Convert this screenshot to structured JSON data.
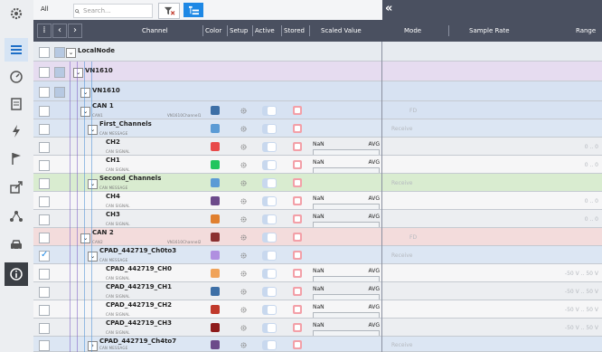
{
  "toolbar": {
    "all_label": "All",
    "search_placeholder": "Search..."
  },
  "header": {
    "columns": [
      "Channel",
      "Color",
      "Setup",
      "Active",
      "Stored",
      "Scaled Value",
      "Mode",
      "Sample Rate",
      "Range"
    ]
  },
  "sidebar": {
    "icons": [
      "gear-icon",
      "list-icon",
      "gauge-icon",
      "document-icon",
      "lightning-icon",
      "flag-icon",
      "export-icon",
      "network-icon",
      "car-icon",
      "info-icon"
    ]
  },
  "rows": [
    {
      "name": "LocalNode",
      "sub": "",
      "indent": 0,
      "mode": "",
      "range": "",
      "checked": false
    },
    {
      "name": "VN1610",
      "sub": "",
      "indent": 1,
      "mode": "",
      "range": "",
      "checked": false
    },
    {
      "name": "VN1610",
      "sub": "",
      "indent": 2,
      "mode": "",
      "range": "",
      "checked": false
    },
    {
      "name": "CAN 1",
      "sub": "CAN1",
      "sub_right": "VN1610Channel1",
      "indent": 3,
      "color": "#3d6fa6",
      "mode": "FD",
      "range": "",
      "checked": false
    },
    {
      "name": "First_Channels",
      "sub": "CAN MESSAGE",
      "indent": 4,
      "color": "#5b9bd5",
      "mode": "Receive",
      "range": "",
      "checked": false
    },
    {
      "name": "CH2",
      "sub": "CAN SIGNAL",
      "indent": 5,
      "color": "#e84a4a",
      "mode": "",
      "range": "0 .. 0",
      "value": "NaN",
      "agg": "AVG",
      "checked": false
    },
    {
      "name": "CH1",
      "sub": "CAN SIGNAL",
      "indent": 5,
      "color": "#22c55e",
      "mode": "",
      "range": "0 .. 0",
      "value": "NaN",
      "agg": "AVG",
      "checked": false
    },
    {
      "name": "Second_Channels",
      "sub": "CAN MESSAGE",
      "indent": 4,
      "color": "#5b9bd5",
      "mode": "Receive",
      "range": "",
      "checked": false
    },
    {
      "name": "CH4",
      "sub": "CAN SIGNAL",
      "indent": 5,
      "color": "#6c4a8a",
      "mode": "",
      "range": "0 .. 0",
      "value": "NaN",
      "agg": "AVG",
      "checked": false
    },
    {
      "name": "CH3",
      "sub": "CAN SIGNAL",
      "indent": 5,
      "color": "#e07f2e",
      "mode": "",
      "range": "0 .. 0",
      "value": "NaN",
      "agg": "AVG",
      "checked": false
    },
    {
      "name": "CAN 2",
      "sub": "CAN2",
      "sub_right": "VN1610Channel2",
      "indent": 3,
      "color": "#8b3030",
      "mode": "FD",
      "range": "",
      "checked": false
    },
    {
      "name": "CPAD_442719_Ch0to3",
      "sub": "CAN MESSAGE",
      "indent": 4,
      "color": "#b08fe0",
      "mode": "Receive",
      "range": "",
      "checked": true
    },
    {
      "name": "CPAD_442719_CH0",
      "sub": "CAN SIGNAL",
      "indent": 5,
      "color": "#f0a35a",
      "mode": "",
      "range": "-50 V .. 50 V",
      "value": "NaN",
      "agg": "AVG",
      "checked": false
    },
    {
      "name": "CPAD_442719_CH1",
      "sub": "CAN SIGNAL",
      "indent": 5,
      "color": "#3d6fa6",
      "mode": "",
      "range": "-50 V .. 50 V",
      "value": "NaN",
      "agg": "AVG",
      "checked": false
    },
    {
      "name": "CPAD_442719_CH2",
      "sub": "CAN SIGNAL",
      "indent": 5,
      "color": "#c0392b",
      "mode": "",
      "range": "-50 V .. 50 V",
      "value": "NaN",
      "agg": "AVG",
      "checked": false
    },
    {
      "name": "CPAD_442719_CH3",
      "sub": "CAN SIGNAL",
      "indent": 5,
      "color": "#8e1b1b",
      "mode": "",
      "range": "-50 V .. 50 V",
      "value": "NaN",
      "agg": "AVG",
      "checked": false
    },
    {
      "name": "CPAD_442719_Ch4to7",
      "sub": "CAN MESSAGE",
      "indent": 4,
      "color": "#6c4a8a",
      "mode": "Receive",
      "range": "",
      "checked": false
    }
  ]
}
